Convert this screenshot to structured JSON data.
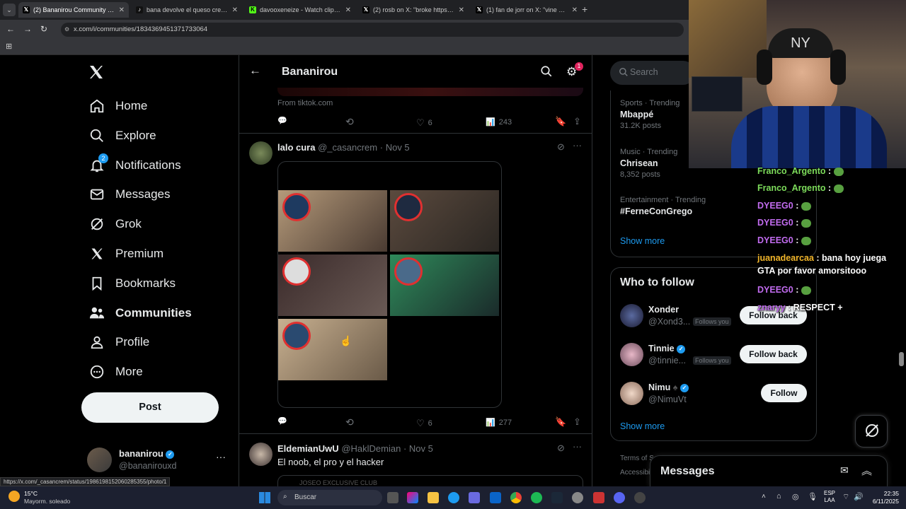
{
  "browser": {
    "tabs": [
      {
        "title": "(2) Bananirou Community / X",
        "icon": "x-logo",
        "color": "#000000"
      },
      {
        "title": "bana devolve el queso cremoso",
        "icon": "tiktok-logo",
        "color": "#111111"
      },
      {
        "title": "davooxeneize - Watch clips on",
        "icon": "kick-logo",
        "color": "#53fc18"
      },
      {
        "title": "(2) rosb on X: \"broke https://t.c",
        "icon": "x-logo",
        "color": "#000000"
      },
      {
        "title": "(1) fan de jorr on X: \"vine a com",
        "icon": "x-logo",
        "color": "#000000"
      }
    ],
    "url": "x.com/i/communities/1834369451371733064",
    "status_url": "https://x.com/_casancrem/status/1986198152060285355/photo/1"
  },
  "sidebar": {
    "items": [
      {
        "label": "Home",
        "icon": "home-icon"
      },
      {
        "label": "Explore",
        "icon": "search-icon"
      },
      {
        "label": "Notifications",
        "icon": "bell-icon",
        "badge": "2"
      },
      {
        "label": "Messages",
        "icon": "mail-icon"
      },
      {
        "label": "Grok",
        "icon": "grok-icon"
      },
      {
        "label": "Premium",
        "icon": "x-logo-icon"
      },
      {
        "label": "Bookmarks",
        "icon": "bookmark-icon"
      },
      {
        "label": "Communities",
        "icon": "people-icon"
      },
      {
        "label": "Profile",
        "icon": "person-icon"
      },
      {
        "label": "More",
        "icon": "more-circle-icon"
      }
    ],
    "post_label": "Post",
    "account": {
      "name": "bananirou",
      "handle": "@bananirouxd"
    }
  },
  "header": {
    "title": "Bananirou",
    "settings_badge": "1"
  },
  "feed": {
    "prev_post": {
      "source": "From tiktok.com",
      "likes": "6",
      "views": "243"
    },
    "post1": {
      "name": "lalo cura",
      "handle": "@_casancrem",
      "date": "Nov 5",
      "likes": "6",
      "views": "277"
    },
    "post2": {
      "name": "EldemianUwU",
      "handle": "@HaklDemian",
      "date": "Nov 5",
      "text": "El noob, el pro y el hacker",
      "preview": "JOSEO EXCLUSIVE CLUB"
    }
  },
  "right": {
    "search_placeholder": "Search",
    "trends": [
      {
        "context": "Sports · Trending",
        "title": "Mbappé",
        "posts": "31.2K posts"
      },
      {
        "context": "Music · Trending",
        "title": "Chrisean",
        "posts": "8,352 posts"
      },
      {
        "context": "Entertainment · Trending",
        "title": "#FerneConGrego",
        "posts": ""
      }
    ],
    "show_more": "Show more",
    "who_to_follow": "Who to follow",
    "follows": [
      {
        "name": "Xonder",
        "handle": "@Xond3...",
        "follows_you": "Follows you",
        "button": "Follow back",
        "verified": false
      },
      {
        "name": "Tinnie",
        "handle": "@tinnie...",
        "follows_you": "Follows you",
        "button": "Follow back",
        "verified": true
      },
      {
        "name": "Nimu",
        "handle": "@NimuVt",
        "follows_you": "",
        "button": "Follow",
        "verified": true
      }
    ],
    "show_more2": "Show more",
    "footer": "Terms of Se",
    "footer2": "Accessibili",
    "messages": "Messages"
  },
  "chat": [
    {
      "user": "Franco_Argento",
      "msg": ":",
      "color": "#7ddc5b"
    },
    {
      "user": "Franco_Argento",
      "msg": ":",
      "color": "#7ddc5b"
    },
    {
      "user": "DYEEG0",
      "msg": ":",
      "color": "#c26cf0"
    },
    {
      "user": "DYEEG0",
      "msg": ":",
      "color": "#c26cf0"
    },
    {
      "user": "DYEEG0",
      "msg": ":",
      "color": "#c26cf0"
    },
    {
      "user": "juanadearcaa",
      "msg": ": bana hoy juega GTA por favor amorsitooo",
      "color": "#f0b429"
    },
    {
      "user": "DYEEG0",
      "msg": ":",
      "color": "#c26cf0"
    },
    {
      "user": "znaryy",
      "msg": ": RESPECT +",
      "color": "#c26cf0"
    }
  ],
  "taskbar": {
    "temp": "15°C",
    "weather": "Mayorm. soleado",
    "search": "Buscar",
    "lang1": "ESP",
    "lang2": "LAA",
    "time": "22:35",
    "date": "6/11/2025"
  }
}
